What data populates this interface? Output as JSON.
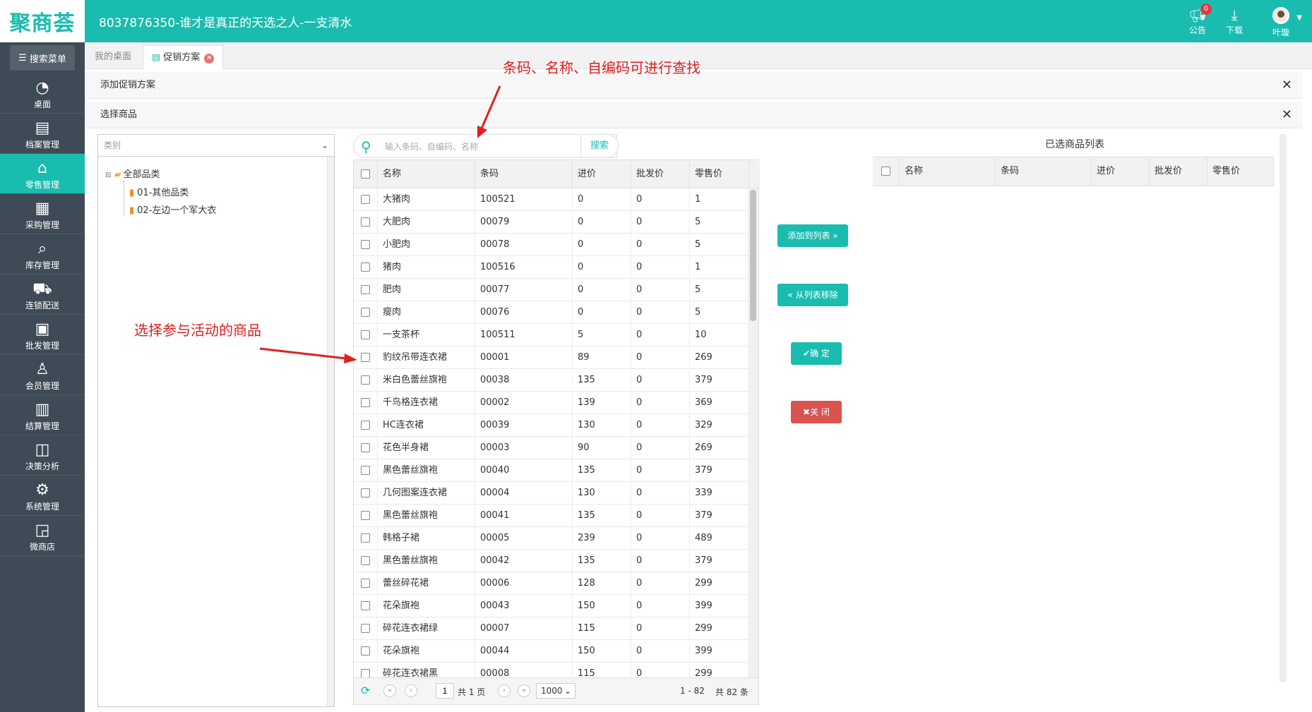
{
  "app": {
    "logo": "聚商荟",
    "title": "8037876350-谁才是真正的天选之人-一支清水",
    "notice_label": "公告",
    "notice_count": "0",
    "download_label": "下载",
    "user_name": "叶璇"
  },
  "sidebar": {
    "search_label": "搜索菜单",
    "items": [
      {
        "label": "桌面",
        "icon": "dashboard-icon",
        "glyph": "◔"
      },
      {
        "label": "档案管理",
        "icon": "archive-icon",
        "glyph": "▤"
      },
      {
        "label": "零售管理",
        "icon": "store-icon",
        "glyph": "⌂"
      },
      {
        "label": "采购管理",
        "icon": "purchase-icon",
        "glyph": "▦"
      },
      {
        "label": "库存管理",
        "icon": "inventory-icon",
        "glyph": "⌕"
      },
      {
        "label": "连锁配送",
        "icon": "delivery-icon",
        "glyph": "⛟"
      },
      {
        "label": "批发管理",
        "icon": "wholesale-icon",
        "glyph": "▣"
      },
      {
        "label": "会员管理",
        "icon": "member-icon",
        "glyph": "♙"
      },
      {
        "label": "结算管理",
        "icon": "settlement-icon",
        "glyph": "▥"
      },
      {
        "label": "决策分析",
        "icon": "analysis-icon",
        "glyph": "◫"
      },
      {
        "label": "系统管理",
        "icon": "settings-icon",
        "glyph": "⚙"
      },
      {
        "label": "微商店",
        "icon": "shop-icon",
        "glyph": "◲"
      }
    ]
  },
  "tabs": {
    "desktop": "我的桌面",
    "promotion": "促销方案"
  },
  "panels": {
    "add_promotion": "添加促销方案",
    "select_products": "选择商品"
  },
  "category": {
    "placeholder": "类别",
    "root": "全部品类",
    "children": [
      "01-其他品类",
      "02-左边一个军大衣"
    ]
  },
  "search": {
    "placeholder": "输入条码、自编码、名称",
    "button": "搜索"
  },
  "table": {
    "headers": [
      "名称",
      "条码",
      "进价",
      "批发价",
      "零售价"
    ],
    "rows": [
      [
        "大猪肉",
        "100521",
        "0",
        "0",
        "1"
      ],
      [
        "大肥肉",
        "00079",
        "0",
        "0",
        "5"
      ],
      [
        "小肥肉",
        "00078",
        "0",
        "0",
        "5"
      ],
      [
        "猪肉",
        "100516",
        "0",
        "0",
        "1"
      ],
      [
        "肥肉",
        "00077",
        "0",
        "0",
        "5"
      ],
      [
        "瘦肉",
        "00076",
        "0",
        "0",
        "5"
      ],
      [
        "一支茶杯",
        "100511",
        "5",
        "0",
        "10"
      ],
      [
        "豹纹吊带连衣裙",
        "00001",
        "89",
        "0",
        "269"
      ],
      [
        "米白色蕾丝旗袍",
        "00038",
        "135",
        "0",
        "379"
      ],
      [
        "千鸟格连衣裙",
        "00002",
        "139",
        "0",
        "369"
      ],
      [
        "HC连衣裙",
        "00039",
        "130",
        "0",
        "329"
      ],
      [
        "花色半身裙",
        "00003",
        "90",
        "0",
        "269"
      ],
      [
        "黑色蕾丝旗袍",
        "00040",
        "135",
        "0",
        "379"
      ],
      [
        "几何图案连衣裙",
        "00004",
        "130",
        "0",
        "339"
      ],
      [
        "黑色蕾丝旗袍",
        "00041",
        "135",
        "0",
        "379"
      ],
      [
        "韩格子裙",
        "00005",
        "239",
        "0",
        "489"
      ],
      [
        "黑色蕾丝旗袍",
        "00042",
        "135",
        "0",
        "379"
      ],
      [
        "蕾丝碎花裙",
        "00006",
        "128",
        "0",
        "299"
      ],
      [
        "花朵旗袍",
        "00043",
        "150",
        "0",
        "399"
      ],
      [
        "碎花连衣裙绿",
        "00007",
        "115",
        "0",
        "299"
      ],
      [
        "花朵旗袍",
        "00044",
        "150",
        "0",
        "399"
      ],
      [
        "碎花连衣裙黑",
        "00008",
        "115",
        "0",
        "299"
      ]
    ]
  },
  "pager": {
    "page": "1",
    "total_pages": "共 1 页",
    "page_size": "1000",
    "range": "1 - 82",
    "total": "共 82 条"
  },
  "actions": {
    "add": "添加到列表",
    "remove": "从列表移除",
    "confirm": "确 定",
    "close": "关 闭"
  },
  "selected": {
    "title": "已选商品列表",
    "headers": [
      "名称",
      "条码",
      "进价",
      "批发价",
      "零售价"
    ]
  },
  "annotations": {
    "search_hint": "条码、名称、自编码可进行查找",
    "select_hint": "选择参与活动的商品"
  }
}
